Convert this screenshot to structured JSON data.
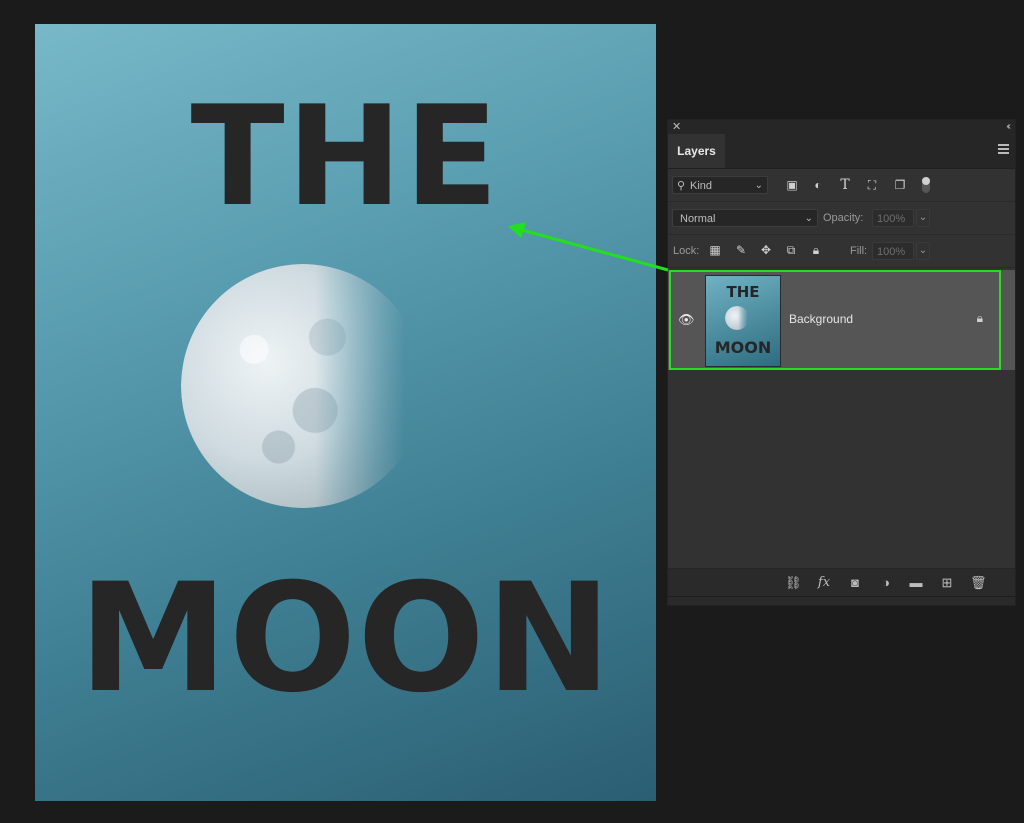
{
  "document": {
    "title_top": "THE",
    "title_bottom": "MOON"
  },
  "panel": {
    "tab_label": "Layers",
    "filter": {
      "kind_label": "Kind",
      "icons": [
        "image-filter-icon",
        "adjustment-filter-icon",
        "type-filter-icon",
        "shape-filter-icon",
        "smart-object-filter-icon"
      ]
    },
    "blend_mode": "Normal",
    "opacity_label": "Opacity:",
    "opacity_value": "100%",
    "lock_label": "Lock:",
    "fill_label": "Fill:",
    "fill_value": "100%",
    "layers": [
      {
        "name": "Background",
        "thumb_top": "THE",
        "thumb_bottom": "MOON",
        "visible": true,
        "locked": true
      }
    ],
    "bottom_icons": [
      "link-layers-icon",
      "fx-icon",
      "layer-mask-icon",
      "adjustment-layer-icon",
      "group-folder-icon",
      "new-layer-icon",
      "delete-layer-icon"
    ],
    "fx_label": "fx"
  },
  "colors": {
    "highlight": "#22e01e",
    "panel_bg": "#323232",
    "selected_layer_bg": "#555555"
  }
}
